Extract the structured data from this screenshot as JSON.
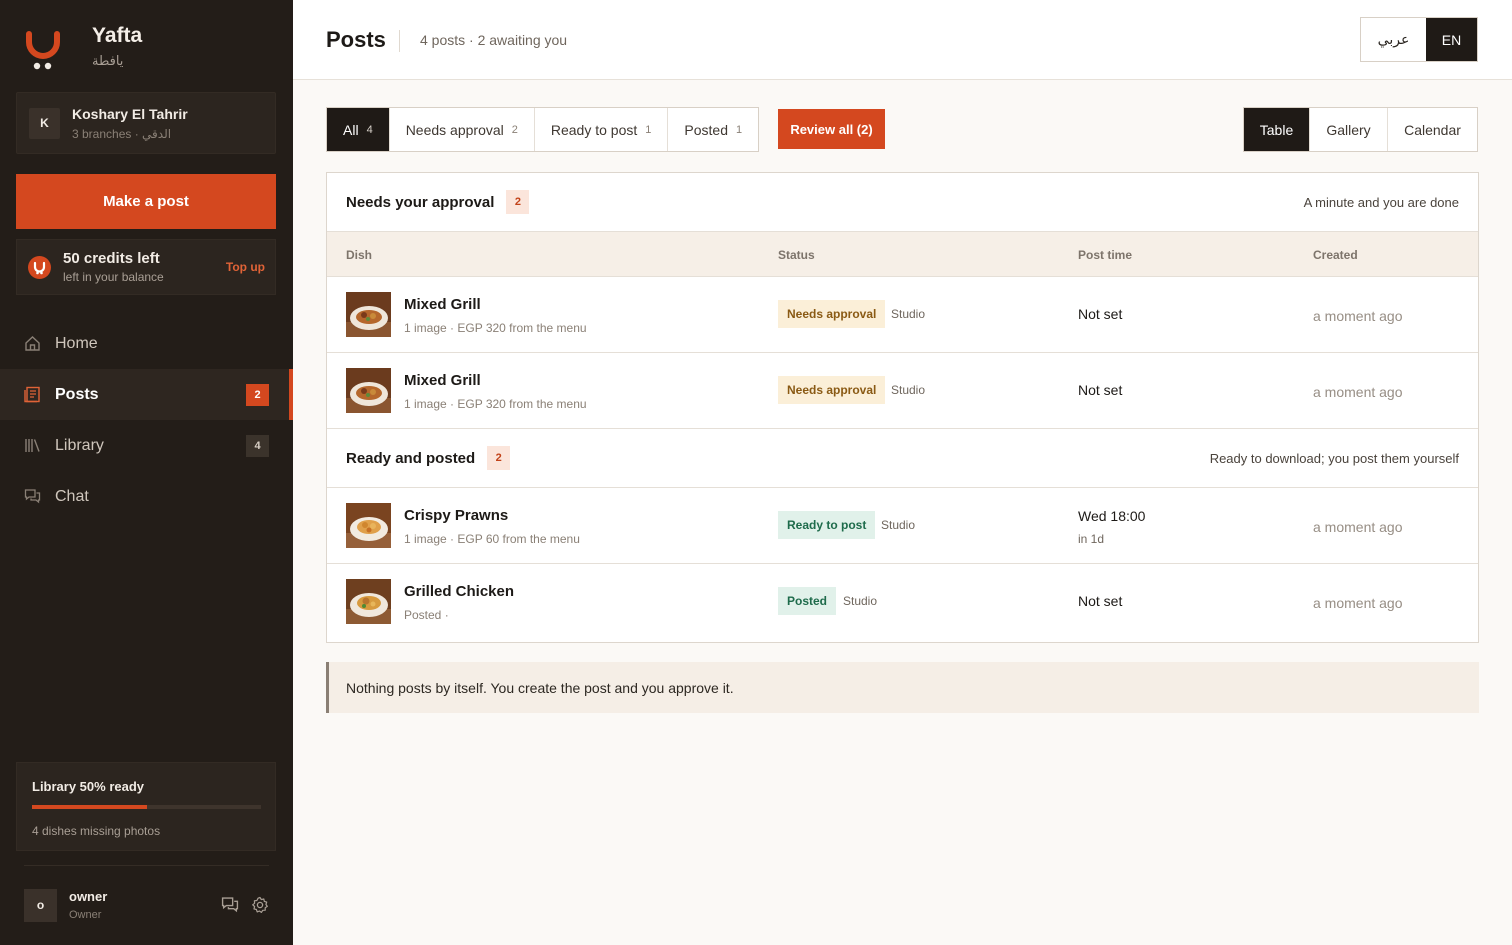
{
  "brand": {
    "name": "Yafta",
    "subtitle": "يافطة"
  },
  "branch": {
    "initial": "K",
    "name": "Koshary El Tahrir",
    "meta": "3 branches · الدقي"
  },
  "make_post_label": "Make a post",
  "credits": {
    "title": "50 credits left",
    "subtitle": "left in your balance",
    "top_up_label": "Top up"
  },
  "nav": [
    {
      "label": "Home",
      "icon": "home-icon"
    },
    {
      "label": "Posts",
      "icon": "posts-icon",
      "badge": "2",
      "active": true
    },
    {
      "label": "Library",
      "icon": "library-icon",
      "badge": "4"
    },
    {
      "label": "Chat",
      "icon": "chat-icon"
    }
  ],
  "library_status": {
    "title": "Library 50% ready",
    "progress": 0.5,
    "subtitle": "4 dishes missing photos"
  },
  "user": {
    "initial": "o",
    "name": "owner",
    "role": "Owner"
  },
  "header": {
    "title": "Posts",
    "subtitle": "4 posts · 2 awaiting you"
  },
  "language": {
    "arabic_label": "عربي",
    "english_label": "EN",
    "active": "EN"
  },
  "filters": [
    {
      "label": "All",
      "count": "4",
      "active": true
    },
    {
      "label": "Needs approval",
      "count": "2"
    },
    {
      "label": "Ready to post",
      "count": "1"
    },
    {
      "label": "Posted",
      "count": "1"
    }
  ],
  "review_all_label": "Review all (2)",
  "views": [
    {
      "label": "Table",
      "active": true
    },
    {
      "label": "Gallery"
    },
    {
      "label": "Calendar"
    }
  ],
  "columns": {
    "dish": "Dish",
    "status": "Status",
    "post_time": "Post time",
    "created": "Created"
  },
  "sections": [
    {
      "title": "Needs your approval",
      "count": "2",
      "note": "A minute and you are done",
      "rows": [
        {
          "dish": "Mixed Grill",
          "meta": "1 image · EGP 320 from the menu",
          "status": "Needs approval",
          "source": "Studio",
          "post_time": "Not set",
          "created": "a moment ago"
        },
        {
          "dish": "Mixed Grill",
          "meta": "1 image · EGP 320 from the menu",
          "status": "Needs approval",
          "source": "Studio",
          "post_time": "Not set",
          "created": "a moment ago"
        }
      ]
    },
    {
      "title": "Ready and posted",
      "count": "2",
      "note": "Ready to download; you post them yourself",
      "rows": [
        {
          "dish": "Crispy Prawns",
          "meta": "1 image · EGP 60 from the menu",
          "status": "Ready to post",
          "source": "Studio",
          "post_time": "Wed 18:00",
          "post_time_sub": "in 1d",
          "created": "a moment ago"
        },
        {
          "dish": "Grilled Chicken",
          "meta": "Posted ·",
          "status": "Posted",
          "source": "Studio",
          "post_time": "Not set",
          "created": "a moment ago"
        }
      ]
    }
  ],
  "notice": "Nothing posts by itself. You create the post and you approve it.",
  "colors": {
    "accent": "#d4481f",
    "sidebar": "#231d18",
    "dark": "#1f1a16"
  }
}
